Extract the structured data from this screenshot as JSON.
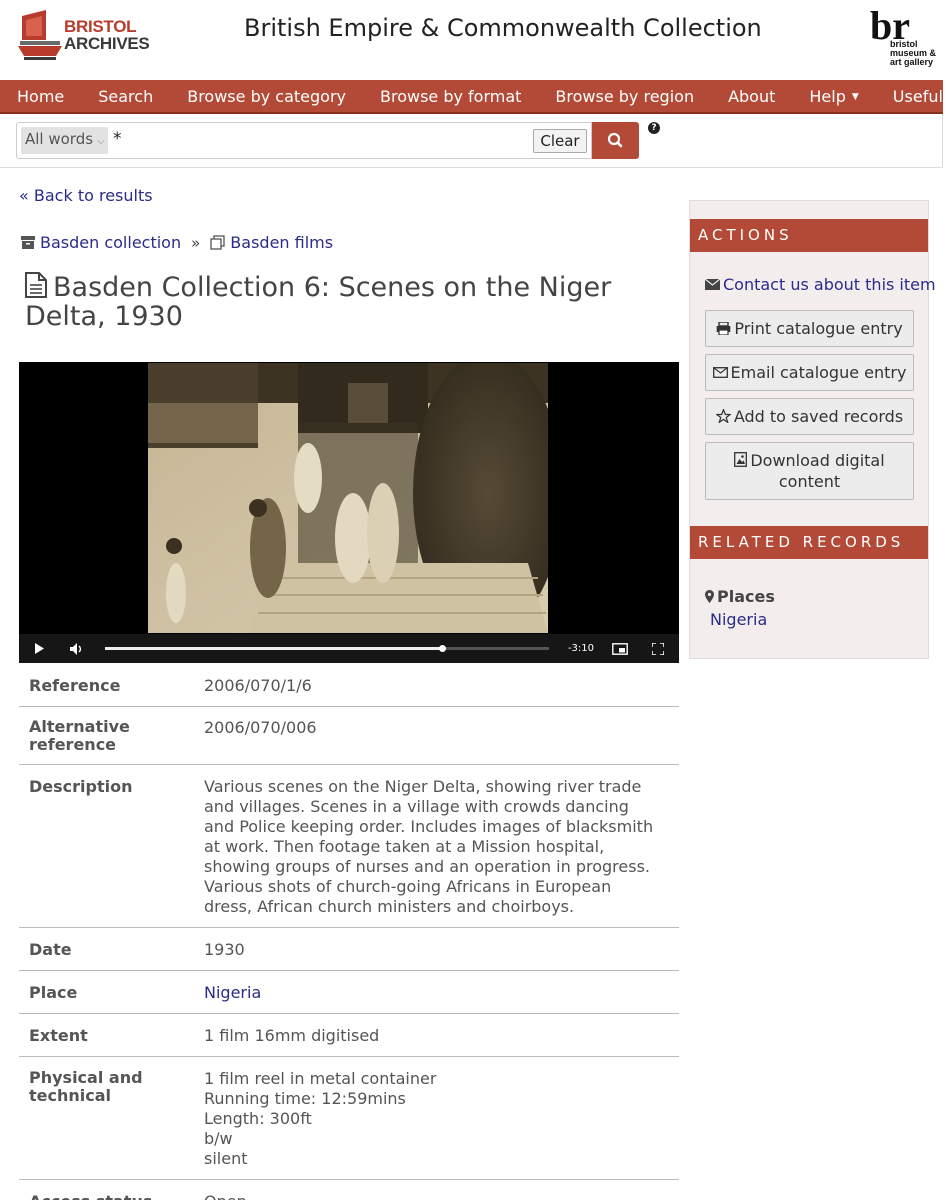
{
  "header": {
    "logo_left_line1": "BRISTOL",
    "logo_left_line2": "ARCHIVES",
    "site_title": "British Empire & Commonwealth Collection",
    "logo_right_mark": "br",
    "logo_right_text": "bristol museum & art gallery"
  },
  "nav": {
    "items": [
      "Home",
      "Search",
      "Browse by category",
      "Browse by format",
      "Browse by region",
      "About",
      "Help",
      "Useful links"
    ]
  },
  "search": {
    "scope": "All words",
    "query": "*",
    "clear_label": "Clear",
    "help": "?"
  },
  "back_link": "Back to results",
  "breadcrumb": {
    "collection": "Basden collection",
    "series": "Basden films"
  },
  "title": "Basden Collection 6: Scenes on the Niger Delta, 1930",
  "video": {
    "time_remaining": "-3:10",
    "progress": 0.759
  },
  "record": {
    "rows": [
      {
        "label": "Reference",
        "value": "2006/070/1/6"
      },
      {
        "label": "Alternative reference",
        "value": "2006/070/006"
      },
      {
        "label": "Description",
        "value": "Various scenes on the Niger Delta, showing river trade and villages. Scenes in a village with crowds dancing and Police keeping order. Includes images of blacksmith at work. Then footage taken at a Mission hospital, showing groups of nurses and an operation in progress. Various shots of church-going Africans in European dress, African church ministers and choirboys."
      },
      {
        "label": "Date",
        "value": "1930"
      },
      {
        "label": "Place",
        "value": "Nigeria"
      },
      {
        "label": "Extent",
        "value": "1 film 16mm digitised"
      },
      {
        "label": "Physical and technical",
        "value": "1 film reel in metal container\nRunning time: 12:59mins\nLength: 300ft\nb/w\nsilent"
      },
      {
        "label": "Access status",
        "value": "Open"
      }
    ]
  },
  "sidebar": {
    "actions_heading": "ACTIONS",
    "contact_link": "Contact us about this item",
    "print_label": "Print catalogue entry",
    "email_label": "Email catalogue entry",
    "save_label": "Add to saved records",
    "download_label": "Download digital content",
    "related_heading": "RELATED RECORDS",
    "places_label": "Places",
    "places_value": "Nigeria"
  },
  "colors": {
    "brand_red": "#b34a37",
    "link_blue": "#2b2b8a",
    "sidebar_bg": "#f3eeed"
  }
}
